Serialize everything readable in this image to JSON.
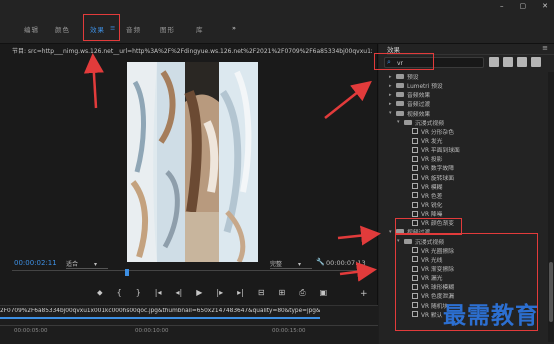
{
  "tabs": [
    {
      "label": "编辑"
    },
    {
      "label": "颜色"
    },
    {
      "label": "效果"
    },
    {
      "label": "音频"
    },
    {
      "label": "图形"
    },
    {
      "label": "库"
    }
  ],
  "tab_more": "»",
  "window_controls": {
    "minimize": "–",
    "maximize": "▢",
    "close": "✕"
  },
  "program_monitor": {
    "title": "节目: src=http___nimg.ws.126.net__url=http%3A%2F%2Fdingyue.ws.126.net%2F2021%2F0709%2F6a85334bj00qvxu1x001kc000hs00qoc.jpg&thumbni",
    "timecode": "00:00:02:11",
    "fit_label": "适合",
    "quality_label": "完整",
    "duration": "00:00:07:13",
    "wrench": "🔧",
    "transport": [
      "⬥",
      "{",
      "}",
      "|◂",
      "◂|",
      "▶",
      "|▸",
      "▸|",
      "⊟",
      "⊞",
      "⎙",
      "▣"
    ],
    "add_button": "+"
  },
  "timeline": {
    "clip_label": "2F0709%2F6a85334bj00qvxu1x001kc000hs00qoc.jpg&thumbnail=650x2147483647&quality=80&type=jpg&refer=http___nimg.ws.12",
    "timecodes": [
      "00:00:05:00",
      "00:00:10:00",
      "00:00:15:00"
    ]
  },
  "effects_panel": {
    "title": "效果",
    "menu_icon": "≡",
    "search_icon": "⌕",
    "search_value": "vr",
    "items": [
      {
        "label": "预设",
        "type": "folder",
        "depth": 0,
        "caret": "▸"
      },
      {
        "label": "Lumetri 预设",
        "type": "folder",
        "depth": 0,
        "caret": "▸"
      },
      {
        "label": "音频效果",
        "type": "folder",
        "depth": 0,
        "caret": "▸"
      },
      {
        "label": "音频过渡",
        "type": "folder",
        "depth": 0,
        "caret": "▸"
      },
      {
        "label": "视频效果",
        "type": "folder",
        "depth": 0,
        "caret": "▾"
      },
      {
        "label": "沉浸式视频",
        "type": "folder",
        "depth": 1,
        "caret": "▾"
      },
      {
        "label": "VR 分形杂色",
        "type": "file",
        "depth": 2
      },
      {
        "label": "VR 发光",
        "type": "file",
        "depth": 2
      },
      {
        "label": "VR 平面到球面",
        "type": "file",
        "depth": 2
      },
      {
        "label": "VR 投影",
        "type": "file",
        "depth": 2
      },
      {
        "label": "VR 数字故障",
        "type": "file",
        "depth": 2
      },
      {
        "label": "VR 旋转球面",
        "type": "file",
        "depth": 2
      },
      {
        "label": "VR 模糊",
        "type": "file",
        "depth": 2
      },
      {
        "label": "VR 色差",
        "type": "file",
        "depth": 2
      },
      {
        "label": "VR 锐化",
        "type": "file",
        "depth": 2
      },
      {
        "label": "VR 降噪",
        "type": "file",
        "depth": 2
      },
      {
        "label": "VR 颜色渐变",
        "type": "file",
        "depth": 2
      },
      {
        "label": "视频过渡",
        "type": "folder",
        "depth": 0,
        "caret": "▾"
      },
      {
        "label": "沉浸式视频",
        "type": "folder",
        "depth": 1,
        "caret": "▾"
      },
      {
        "label": "VR 光圈擦除",
        "type": "file",
        "depth": 2
      },
      {
        "label": "VR 光线",
        "type": "file",
        "depth": 2
      },
      {
        "label": "VR 渐变擦除",
        "type": "file",
        "depth": 2
      },
      {
        "label": "VR 漏光",
        "type": "file",
        "depth": 2
      },
      {
        "label": "VR 球形模糊",
        "type": "file",
        "depth": 2
      },
      {
        "label": "VR 色度泄漏",
        "type": "file",
        "depth": 2
      },
      {
        "label": "VR 随机块",
        "type": "file",
        "depth": 2
      },
      {
        "label": "VR 默认",
        "type": "file",
        "depth": 2
      }
    ]
  },
  "watermark": "最需教育",
  "colors": {
    "accent": "#3d8fe3",
    "annotation": "#e23b3b",
    "watermark": "#2c6fd1"
  }
}
